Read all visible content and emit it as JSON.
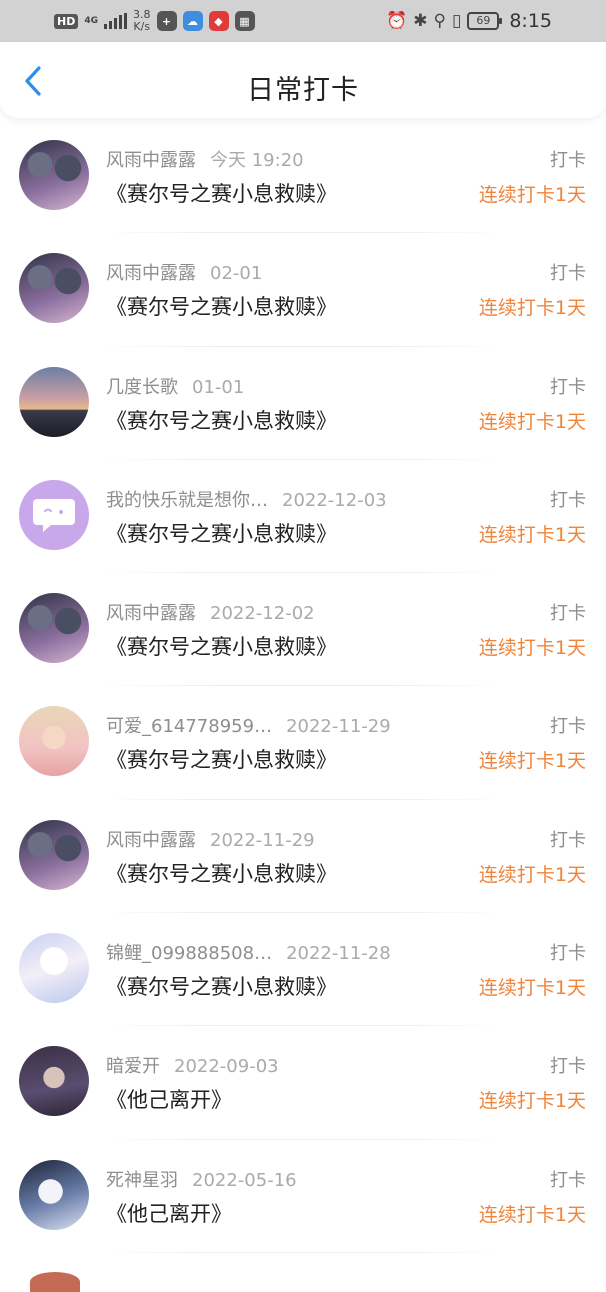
{
  "status_bar": {
    "hd": "HD",
    "network": "4G",
    "speed_value": "3.8",
    "speed_unit": "K/s",
    "battery": "69",
    "time": "8:15",
    "icons": [
      "hd-icon",
      "signal-icon",
      "plus-app-icon",
      "cloud-app-icon",
      "red-app-icon",
      "calendar-app-icon",
      "alarm-icon",
      "bluetooth-icon",
      "location-icon",
      "vibrate-icon",
      "battery-icon"
    ]
  },
  "nav": {
    "back_icon": "chevron-left-icon",
    "title": "日常打卡"
  },
  "colors": {
    "accent_blue": "#2c8ee8",
    "streak_orange": "#f0843a",
    "muted_gray": "#999999",
    "title_black": "#222222"
  },
  "checkins": [
    {
      "user": "风雨中露露",
      "time": "今天 19:20",
      "title": "《赛尔号之赛小息救赎》",
      "tag": "打卡",
      "streak": "连续打卡1天",
      "avatar": "av-a"
    },
    {
      "user": "风雨中露露",
      "time": "02-01",
      "title": "《赛尔号之赛小息救赎》",
      "tag": "打卡",
      "streak": "连续打卡1天",
      "avatar": "av-a"
    },
    {
      "user": "几度长歌",
      "time": "01-01",
      "title": "《赛尔号之赛小息救赎》",
      "tag": "打卡",
      "streak": "连续打卡1天",
      "avatar": "av-b"
    },
    {
      "user": "我的快乐就是想你…",
      "time": "2022-12-03",
      "title": "《赛尔号之赛小息救赎》",
      "tag": "打卡",
      "streak": "连续打卡1天",
      "avatar": "av-c"
    },
    {
      "user": "风雨中露露",
      "time": "2022-12-02",
      "title": "《赛尔号之赛小息救赎》",
      "tag": "打卡",
      "streak": "连续打卡1天",
      "avatar": "av-a"
    },
    {
      "user": "可爱_614778959…",
      "time": "2022-11-29",
      "title": "《赛尔号之赛小息救赎》",
      "tag": "打卡",
      "streak": "连续打卡1天",
      "avatar": "av-d"
    },
    {
      "user": "风雨中露露",
      "time": "2022-11-29",
      "title": "《赛尔号之赛小息救赎》",
      "tag": "打卡",
      "streak": "连续打卡1天",
      "avatar": "av-a"
    },
    {
      "user": "锦鲤_099888508…",
      "time": "2022-11-28",
      "title": "《赛尔号之赛小息救赎》",
      "tag": "打卡",
      "streak": "连续打卡1天",
      "avatar": "av-e"
    },
    {
      "user": "暗爱开",
      "time": "2022-09-03",
      "title": "《他己离开》",
      "tag": "打卡",
      "streak": "连续打卡1天",
      "avatar": "av-f"
    },
    {
      "user": "死神星羽",
      "time": "2022-05-16",
      "title": "《他己离开》",
      "tag": "打卡",
      "streak": "连续打卡1天",
      "avatar": "av-g"
    }
  ]
}
